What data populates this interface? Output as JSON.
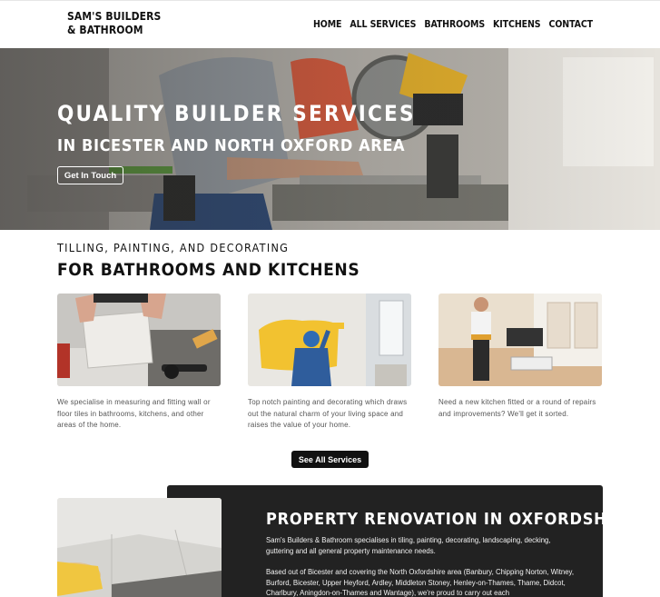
{
  "header": {
    "logo_line1": "SAM'S BUILDERS",
    "logo_line2": "& BATHROOM",
    "nav": [
      "HOME",
      "ALL SERVICES",
      "BATHROOMS",
      "KITCHENS",
      "CONTACT"
    ]
  },
  "hero": {
    "title": "QUALITY BUILDER SERVICES",
    "subtitle": "IN BICESTER AND NORTH OXFORD AREA",
    "button": "Get In Touch"
  },
  "services": {
    "kicker": "TILLING, PAINTING, AND DECORATING",
    "title": "FOR BATHROOMS AND KITCHENS",
    "cards": [
      {
        "text": "We specialise in measuring and fitting wall or floor tiles in bathrooms, kitchens, and other areas of the home."
      },
      {
        "text": "Top notch painting and decorating which draws out the natural charm of your living space and raises the value of your home."
      },
      {
        "text": "Need a new kitchen fitted or a round of repairs and improvements? We'll get it sorted."
      }
    ],
    "button": "See All Services"
  },
  "renovation": {
    "title": "PROPERTY RENOVATION IN OXFORDSHIRE",
    "p1": "Sam's Builders & Bathroom specialises in tiling, painting, decorating, landscaping, decking, guttering and all general property maintenance needs.",
    "p2": "Based out of Bicester and covering the North Oxfordshire area (Banbury, Chipping Norton, Witney, Burford, Bicester, Upper Heyford, Ardley, Middleton Stoney, Henley-on-Thames, Thame, Didcot, Charlbury, Aningdon-on-Thames and Wantage), we're proud  to carry out each"
  },
  "colors": {
    "dark_panel": "#222222",
    "accent_yellow": "#f2c230",
    "worker_blue": "#2f5d9c"
  }
}
